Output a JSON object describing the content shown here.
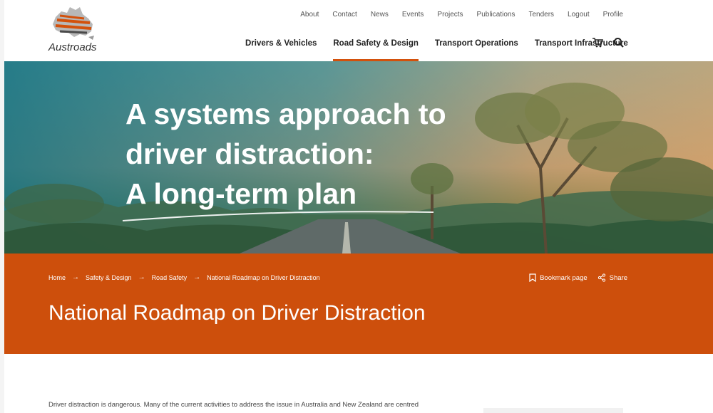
{
  "brand": {
    "name": "Austroads"
  },
  "utility_nav": [
    "About",
    "Contact",
    "News",
    "Events",
    "Projects",
    "Publications",
    "Tenders",
    "Logout",
    "Profile"
  ],
  "main_nav": {
    "items": [
      {
        "label": "Drivers & Vehicles",
        "active": false
      },
      {
        "label": "Road Safety & Design",
        "active": true
      },
      {
        "label": "Transport Operations",
        "active": false
      },
      {
        "label": "Transport Infrastructure",
        "active": false
      }
    ],
    "icons": [
      "cart-icon",
      "search-icon"
    ]
  },
  "hero": {
    "lines": [
      "A systems approach to",
      "driver distraction:",
      "A long-term plan"
    ]
  },
  "breadcrumb": {
    "items": [
      "Home",
      "Safety & Design",
      "Road Safety",
      "National Roadmap on Driver Distraction"
    ],
    "separator": "→"
  },
  "actions": {
    "bookmark": "Bookmark page",
    "share": "Share"
  },
  "page_title": "National Roadmap on Driver Distraction",
  "intro_text": "Driver distraction is dangerous. Many of the current activities to address the issue in Australia and New Zealand are centred",
  "colors": {
    "accent": "#cd4f0c",
    "hero_teal": "#167382"
  }
}
